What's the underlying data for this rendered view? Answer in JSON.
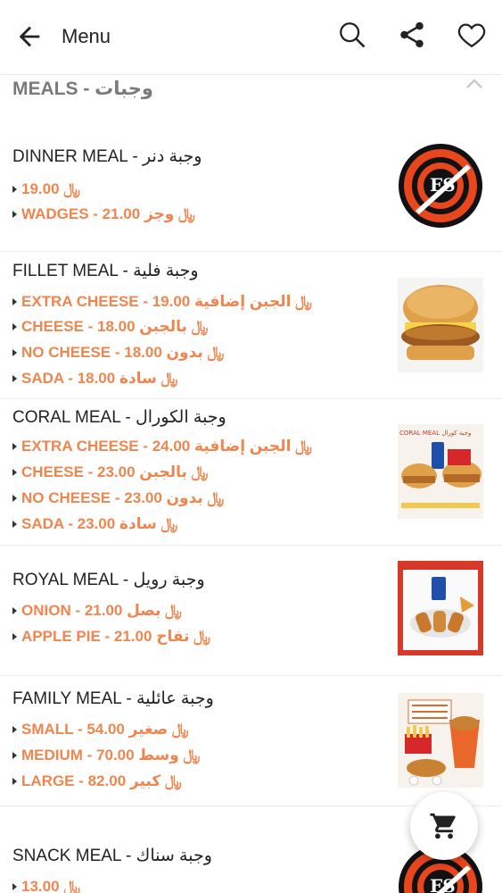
{
  "header": {
    "title": "Menu",
    "icons": [
      "arrow-back-icon",
      "search-icon",
      "share-icon",
      "heart-icon"
    ]
  },
  "section": {
    "title": "MEALS - وجبات",
    "collapse_icon": "chevron-up-icon"
  },
  "currency": "﷼",
  "items": [
    {
      "name": "DINNER MEAL - وجبة دنر",
      "image": "fs-logo",
      "options": [
        {
          "label": "19.00 ﷼"
        },
        {
          "label": "WADGES - 21.00 ﷼ وجز"
        }
      ]
    },
    {
      "name": "FILLET MEAL - وجبة فلية",
      "image": "burger-photo",
      "options": [
        {
          "label": "EXTRA CHEESE - 19.00 ﷼ الجبن إضافية"
        },
        {
          "label": "CHEESE - 18.00 ﷼ بالجبن"
        },
        {
          "label": "NO CHEESE - 18.00 ﷼ بدون"
        },
        {
          "label": "SADA - 18.00 ﷼ سادة"
        }
      ]
    },
    {
      "name": "CORAL MEAL - وجبة الكورال",
      "image": "coral-meal-photo",
      "image_caption": "CORAL MEAL  وجبة كورال",
      "options": [
        {
          "label": "EXTRA CHEESE - 24.00 ﷼ الجبن إضافية"
        },
        {
          "label": "CHEESE - 23.00 ﷼ بالجبن"
        },
        {
          "label": "NO CHEESE - 23.00 ﷼ بدون"
        },
        {
          "label": "SADA - 23.00 ﷼ سادة"
        }
      ]
    },
    {
      "name": "ROYAL MEAL - وجبة رويل",
      "image": "royal-meal-photo",
      "options": [
        {
          "label": "ONION - 21.00 ﷼ بصل"
        },
        {
          "label": "APPLE PIE - 21.00 ﷼ تفاح"
        }
      ]
    },
    {
      "name": "FAMILY MEAL - وجبة عائلية",
      "image": "family-meal-photo",
      "options": [
        {
          "label": "SMALL - 54.00 ﷼ صغير"
        },
        {
          "label": "MEDIUM - 70.00 ﷼ وسط"
        },
        {
          "label": "LARGE - 82.00 ﷼ كبير"
        }
      ]
    },
    {
      "name": "SNACK MEAL - وجبة سناك",
      "image": "fs-logo",
      "options": [
        {
          "label": "13.00 ﷼"
        }
      ]
    }
  ],
  "fab": {
    "icon": "shopping-cart-icon"
  },
  "colors": {
    "price": "#f0864f",
    "section_title": "#7a7a7a",
    "logo_red": "#e8461c"
  }
}
